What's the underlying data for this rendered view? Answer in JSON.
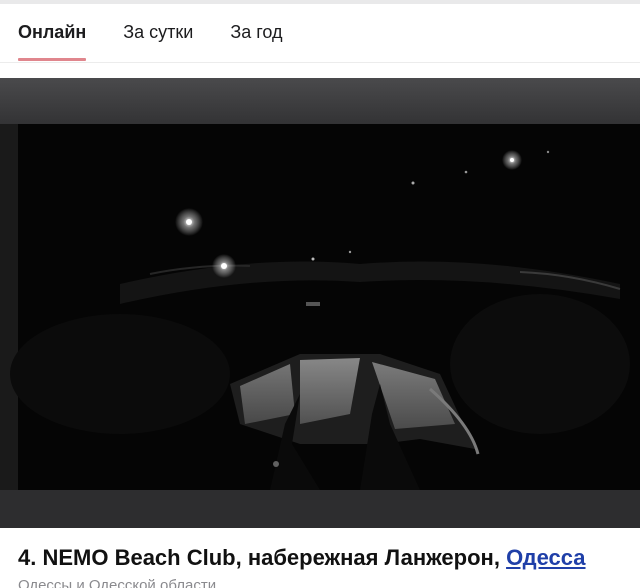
{
  "tabs": [
    {
      "label": "Онлайн",
      "active": true
    },
    {
      "label": "За сутки",
      "active": false
    },
    {
      "label": "За год",
      "active": false
    }
  ],
  "accent_color": "#e0868d",
  "link_color": "#1f3fa8",
  "camera": {
    "title_prefix": "4. NEMO Beach Club, набережная Ланжерон, ",
    "city_link": "Одесса",
    "subtitle": "Одессы и Одесской области"
  }
}
